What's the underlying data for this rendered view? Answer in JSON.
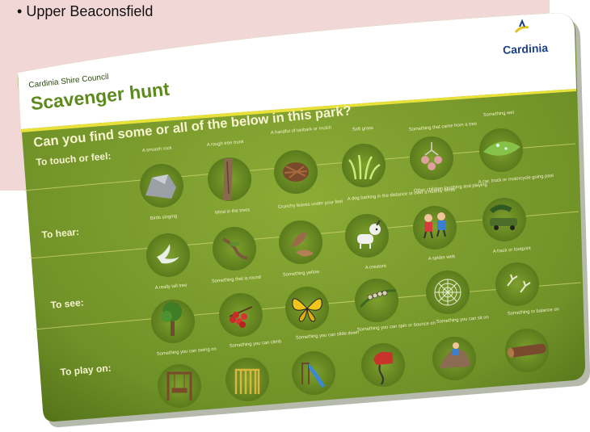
{
  "page": {
    "bullet_text": "Upper Beaconsfield"
  },
  "sign": {
    "org": "Cardinia Shire Council",
    "title": "Scavenger hunt",
    "question": "Can you find some or all of the below in this park?",
    "logo_text": "Cardinia",
    "colors": {
      "board": "#7a9c2f",
      "band": "#e8e13a",
      "text": "#f6f3cf",
      "logo_accent": "#e5c21a",
      "logo_text": "#1b3f8a"
    }
  },
  "rows": [
    {
      "label": "To touch or feel:",
      "items": [
        {
          "caption": "A smooth rock",
          "icon": "rock-icon"
        },
        {
          "caption": "A rough tree trunk",
          "icon": "tree-trunk-icon"
        },
        {
          "caption": "A handful of tanbark or mulch",
          "icon": "mulch-icon"
        },
        {
          "caption": "Soft grass",
          "icon": "grass-icon"
        },
        {
          "caption": "Something that came from a tree",
          "icon": "gumnut-icon"
        },
        {
          "caption": "Something wet",
          "icon": "wet-leaf-icon"
        }
      ]
    },
    {
      "label": "To hear:",
      "items": [
        {
          "caption": "Birds singing",
          "icon": "bird-icon"
        },
        {
          "caption": "Wind in the trees",
          "icon": "windy-branch-icon"
        },
        {
          "caption": "Crunchy leaves under your feet",
          "icon": "dry-leaves-icon"
        },
        {
          "caption": "A dog barking in the distance or over a nearby fence",
          "icon": "dog-icon"
        },
        {
          "caption": "Other children laughing and playing",
          "icon": "children-icon"
        },
        {
          "caption": "A car, truck or motorcycle going past",
          "icon": "vehicle-icon"
        }
      ]
    },
    {
      "label": "To see:",
      "items": [
        {
          "caption": "A really tall tree",
          "icon": "tall-tree-icon"
        },
        {
          "caption": "Something that is round",
          "icon": "berries-icon"
        },
        {
          "caption": "Something yellow",
          "icon": "butterfly-icon"
        },
        {
          "caption": "A creature",
          "icon": "caterpillar-icon"
        },
        {
          "caption": "A spider web",
          "icon": "spider-web-icon"
        },
        {
          "caption": "A track or footprint",
          "icon": "footprint-icon"
        }
      ]
    },
    {
      "label": "To play on:",
      "items": [
        {
          "caption": "Something you can swing on",
          "icon": "swing-icon"
        },
        {
          "caption": "Something you can climb",
          "icon": "climbing-frame-icon"
        },
        {
          "caption": "Something you can slide down",
          "icon": "slide-icon"
        },
        {
          "caption": "Something you can spin or bounce on",
          "icon": "spring-rider-icon"
        },
        {
          "caption": "Something you can sit on",
          "icon": "rock-seat-icon"
        },
        {
          "caption": "Something to balance on",
          "icon": "log-icon"
        }
      ]
    }
  ]
}
